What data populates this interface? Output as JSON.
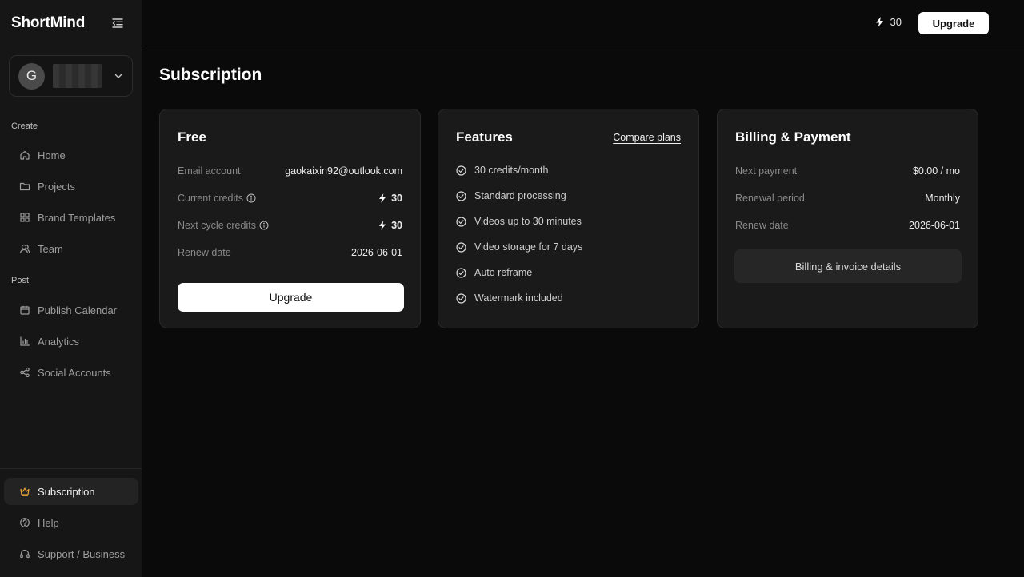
{
  "app": {
    "name": "ShortMind",
    "page_title": "Subscription"
  },
  "account": {
    "avatar_letter": "G"
  },
  "sidebar": {
    "section_create": "Create",
    "section_post": "Post",
    "items_create": [
      {
        "label": "Home",
        "icon": "home-icon"
      },
      {
        "label": "Projects",
        "icon": "folder-icon"
      },
      {
        "label": "Brand Templates",
        "icon": "grid-icon"
      },
      {
        "label": "Team",
        "icon": "team-icon"
      }
    ],
    "items_post": [
      {
        "label": "Publish Calendar",
        "icon": "calendar-icon"
      },
      {
        "label": "Analytics",
        "icon": "chart-icon"
      },
      {
        "label": "Social Accounts",
        "icon": "share-icon"
      }
    ],
    "items_bottom": [
      {
        "label": "Subscription",
        "icon": "crown-icon",
        "active": true
      },
      {
        "label": "Help",
        "icon": "help-icon"
      },
      {
        "label": "Support / Business",
        "icon": "headset-icon"
      }
    ]
  },
  "topbar": {
    "credits": "30",
    "upgrade_label": "Upgrade"
  },
  "plan_card": {
    "title": "Free",
    "email_label": "Email account",
    "email_value": "gaokaixin92@outlook.com",
    "current_credits_label": "Current credits",
    "current_credits_value": "30",
    "next_cycle_label": "Next cycle credits",
    "next_cycle_value": "30",
    "renew_label": "Renew date",
    "renew_value": "2026-06-01",
    "upgrade_label": "Upgrade"
  },
  "features_card": {
    "title": "Features",
    "compare_label": "Compare plans",
    "items": [
      "30 credits/month",
      "Standard processing",
      "Videos up to 30 minutes",
      "Video storage for 7 days",
      "Auto reframe",
      "Watermark included"
    ]
  },
  "billing_card": {
    "title": "Billing & Payment",
    "next_payment_label": "Next payment",
    "next_payment_value": "$0.00 / mo",
    "renewal_period_label": "Renewal period",
    "renewal_period_value": "Monthly",
    "renew_date_label": "Renew date",
    "renew_date_value": "2026-06-01",
    "details_label": "Billing & invoice details"
  },
  "colors": {
    "accent_active_icon": "#e8a33a",
    "background": "#0a0a0a",
    "card": "#1a1a1a"
  }
}
